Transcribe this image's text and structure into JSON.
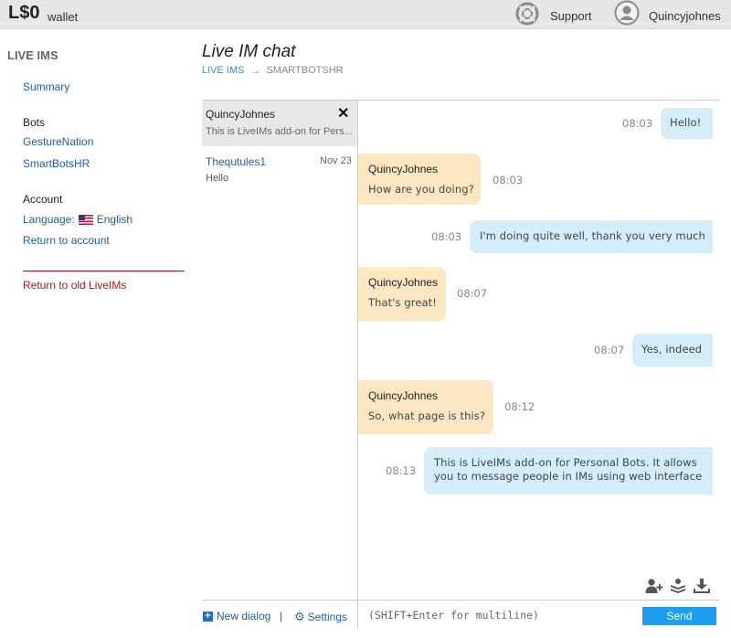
{
  "topbar": {
    "balance": "L$0",
    "wallet_label": "wallet",
    "support_label": "Support",
    "username": "Quincyjohnes"
  },
  "sidebar": {
    "title": "LIVE IMS",
    "summary": "Summary",
    "bots_heading": "Bots",
    "bots": [
      "GestureNation",
      "SmartBotsHR"
    ],
    "account_heading": "Account",
    "language_label": "Language:",
    "language_value": "English",
    "return_account": "Return to account",
    "return_old": "Return to old LiveIMs"
  },
  "header": {
    "title": "Live IM chat",
    "breadcrumb_link": "LIVE IMS",
    "breadcrumb_arrow": "→",
    "breadcrumb_current": "SMARTBOTSHR"
  },
  "dialogs": [
    {
      "name": "QuincyJohnes",
      "preview": "This is LiveIMs add-on for Pers...",
      "date": "",
      "active": true
    },
    {
      "name": "Thequtules1",
      "preview": "Hello",
      "date": "Nov 23",
      "active": false
    }
  ],
  "messages": [
    {
      "direction": "out",
      "sender": "",
      "text": "Hello!",
      "time": "08:03"
    },
    {
      "direction": "in",
      "sender": "QuincyJohnes",
      "text": "How are you doing?",
      "time": "08:03"
    },
    {
      "direction": "out",
      "sender": "",
      "text": "I'm doing quite well, thank you very much",
      "time": "08:03"
    },
    {
      "direction": "in",
      "sender": "QuincyJohnes",
      "text": "That's great!",
      "time": "08:07"
    },
    {
      "direction": "out",
      "sender": "",
      "text": "Yes, indeed",
      "time": "08:07"
    },
    {
      "direction": "in",
      "sender": "QuincyJohnes",
      "text": "So, what page is this?",
      "time": "08:12"
    },
    {
      "direction": "out",
      "sender": "",
      "text": "This is LiveIMs add-on for Personal Bots. It allows you to message people in IMs using web interface",
      "time": "08:13"
    }
  ],
  "tools": [
    "add-user-icon",
    "layers-icon",
    "download-icon"
  ],
  "footer": {
    "new_dialog": "New dialog",
    "separator": "|",
    "settings": "Settings",
    "input_placeholder": "(SHIFT+Enter for multiline)",
    "send": "Send"
  },
  "colors": {
    "outgoing_bubble": "#d5ecf9",
    "incoming_bubble": "#fde7c2",
    "send_button": "#1aa0ef",
    "link": "#1f5ea8",
    "old_link": "#a01c1c"
  }
}
